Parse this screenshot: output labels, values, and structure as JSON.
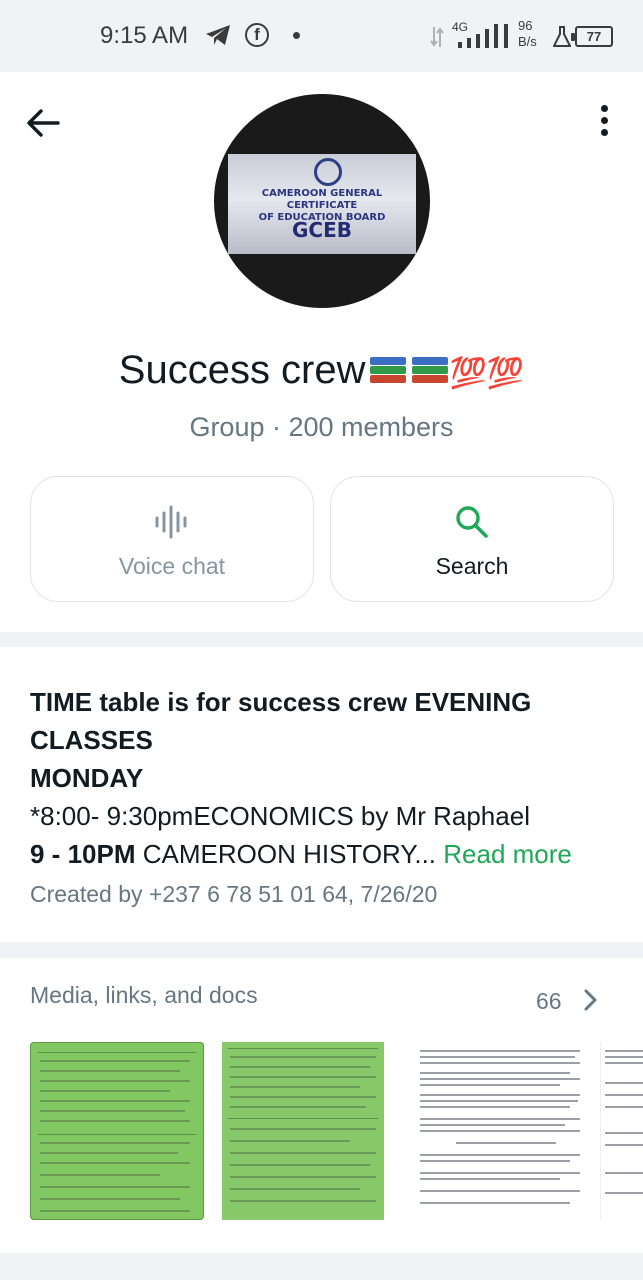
{
  "status_bar": {
    "time": "9:15 AM",
    "network": "4G",
    "speed_value": "96",
    "speed_unit": "B/s",
    "battery": "77"
  },
  "header": {
    "avatar_sign_line1": "CAMEROON GENERAL CERTIFICATE",
    "avatar_sign_line2": "OF EDUCATION BOARD",
    "avatar_sign_line3": "GCEB",
    "group_name": "Success crew",
    "group_emoji": "💯💯",
    "group_subtitle": "Group · 200 members",
    "voice_chat_label": "Voice chat",
    "search_label": "Search"
  },
  "description": {
    "line1": "TIME table is for success crew EVENING CLASSES",
    "line2": "MONDAY",
    "line3": "*8:00- 9:30pmECONOMICS by Mr Raphael",
    "line4_bold": "9 - 10PM",
    "line4_rest": " CAMEROON HISTORY...",
    "read_more": "Read more",
    "created_by": "Created by +237 6 78 51 01 64, 7/26/20"
  },
  "media": {
    "title": "Media, links, and docs",
    "count": "66"
  },
  "colors": {
    "accent_green": "#1fa855",
    "background": "#f0f2f5",
    "muted_text": "#667781"
  }
}
